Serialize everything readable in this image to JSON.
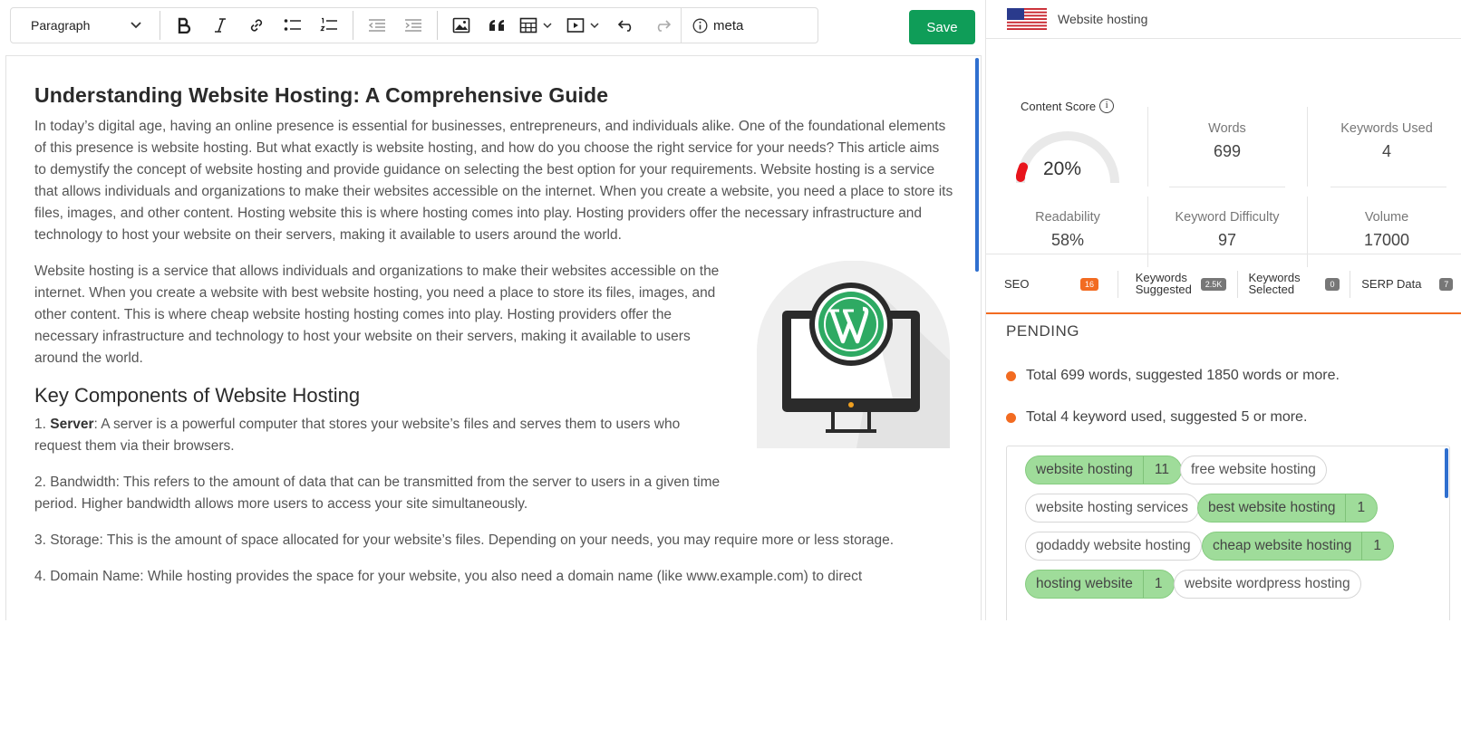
{
  "toolbar": {
    "block_format": "Paragraph",
    "meta_label": "meta",
    "save_label": "Save",
    "icons": [
      "bold-icon",
      "italic-icon",
      "link-icon",
      "bullet-list-icon",
      "numbered-list-icon",
      "outdent-icon",
      "indent-icon",
      "image-icon",
      "blockquote-icon",
      "table-icon",
      "media-icon",
      "undo-icon",
      "redo-icon",
      "info-icon"
    ]
  },
  "document": {
    "title": "Understanding Website Hosting: A Comprehensive Guide",
    "intro": "In today’s digital age, having an online presence is essential for businesses, entrepreneurs, and individuals alike. One of the foundational elements of this presence is website hosting. But what exactly is website hosting, and how do you choose the right service for your needs? This article aims to demystify the concept of website hosting and provide guidance on selecting the best option for your requirements. Website hosting is a service that allows individuals and organizations to make their websites accessible on the internet. When you create a website, you need a place to store its files, images, and other content. Hosting website this is where hosting comes into play. Hosting providers offer the necessary infrastructure and technology to host your website on their servers, making it available to users around the world.",
    "para2": "Website hosting is a service that allows individuals and organizations to make their websites accessible on the internet. When you create a website with best website hosting, you need a place to store its files, images, and other content. This is where cheap website hosting hosting comes into play. Hosting providers offer the necessary infrastructure and technology to host your website on their servers, making it available to users around the world.",
    "subheading": "Key Components of Website Hosting",
    "items": [
      {
        "prefix": "1. ",
        "term": "Server",
        "text": ": A server is a powerful computer that stores your website’s files and serves them to users who request them via their browsers."
      },
      {
        "prefix": "",
        "term": "",
        "text": "2. Bandwidth: This refers to the amount of data that can be transmitted from the server to users in a given time period. Higher bandwidth allows more users to access your site simultaneously."
      },
      {
        "prefix": "",
        "term": "",
        "text": "3. Storage: This is the amount of space allocated for your website’s files. Depending on your needs, you may require more or less storage."
      },
      {
        "prefix": "",
        "term": "",
        "text": "4. Domain Name: While hosting provides the space for your website, you also need a domain name (like www.example.com) to direct"
      }
    ]
  },
  "panel": {
    "keyword": "Website hosting",
    "content_score_label": "Content Score",
    "content_score": "20%",
    "content_score_fraction": 0.2,
    "stats": [
      {
        "label": "Words",
        "value": "699"
      },
      {
        "label": "Keywords Used",
        "value": "4"
      },
      {
        "label": "Readability",
        "value": "58%"
      },
      {
        "label": "Keyword Difficulty",
        "value": "97"
      },
      {
        "label": "Volume",
        "value": "17000"
      }
    ],
    "tabs": [
      {
        "label": "SEO",
        "badge": "16"
      },
      {
        "label": "Keywords Suggested",
        "badge": "2.5K"
      },
      {
        "label": "Keywords Selected",
        "badge": "0"
      },
      {
        "label": "SERP Data",
        "badge": "7"
      }
    ],
    "pending_title": "PENDING",
    "pending": [
      "Total 699 words, suggested 1850 words or more.",
      "Total 4 keyword used, suggested 5 or more."
    ],
    "keywords": [
      {
        "text": "website hosting",
        "count": "11",
        "used": true
      },
      {
        "text": "free website hosting",
        "count": "",
        "used": false
      },
      {
        "text": "website hosting services",
        "count": "",
        "used": false
      },
      {
        "text": "best website hosting",
        "count": "1",
        "used": true
      },
      {
        "text": "godaddy website hosting",
        "count": "",
        "used": false
      },
      {
        "text": "cheap website hosting",
        "count": "1",
        "used": true
      },
      {
        "text": "hosting website",
        "count": "1",
        "used": true
      },
      {
        "text": "website wordpress hosting",
        "count": "",
        "used": false
      }
    ],
    "colors": {
      "accent": "#f26b21",
      "save": "#0f9d58",
      "used_chip": "#9fdc9a",
      "gauge_red": "#e8141c"
    }
  }
}
